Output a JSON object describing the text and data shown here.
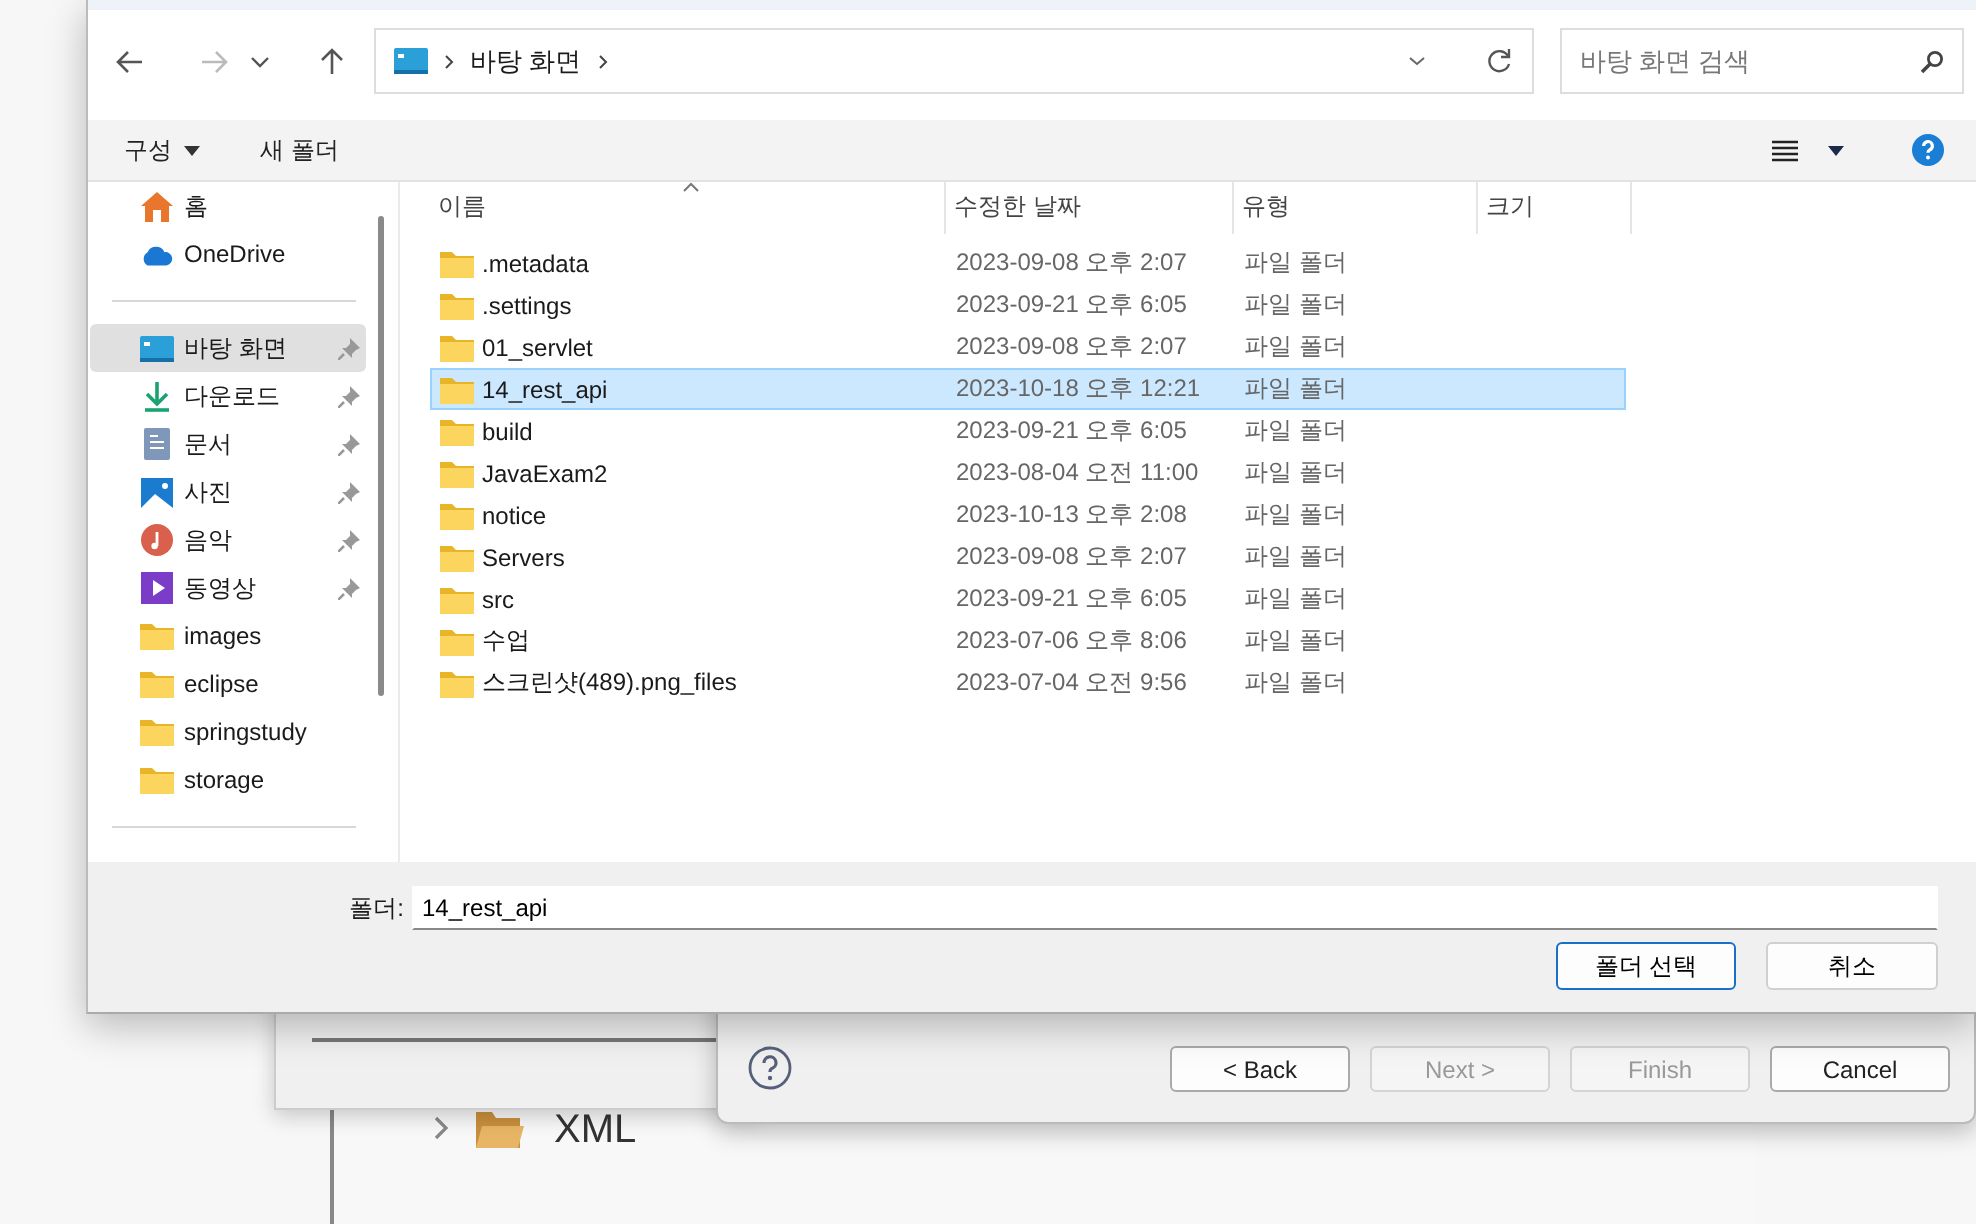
{
  "dialog": {
    "nav": {
      "breadcrumb": [
        "바탕 화면"
      ],
      "search": {
        "placeholder": "바탕 화면 검색"
      }
    },
    "toolbar": {
      "organize": "구성",
      "new_folder": "새 폴더"
    },
    "sidebar": {
      "groups": [
        {
          "items": [
            {
              "label": "홈",
              "kind": "home",
              "pinned": false,
              "selected": false
            },
            {
              "label": "OneDrive",
              "kind": "cloud",
              "pinned": false,
              "selected": false
            }
          ]
        },
        {
          "items": [
            {
              "label": "바탕 화면",
              "kind": "desktop",
              "pinned": true,
              "selected": true
            },
            {
              "label": "다운로드",
              "kind": "download",
              "pinned": true,
              "selected": false
            },
            {
              "label": "문서",
              "kind": "document",
              "pinned": true,
              "selected": false
            },
            {
              "label": "사진",
              "kind": "photo",
              "pinned": true,
              "selected": false
            },
            {
              "label": "음악",
              "kind": "music",
              "pinned": true,
              "selected": false
            },
            {
              "label": "동영상",
              "kind": "video",
              "pinned": true,
              "selected": false
            },
            {
              "label": "images",
              "kind": "folder",
              "pinned": false,
              "selected": false
            },
            {
              "label": "eclipse",
              "kind": "folder",
              "pinned": false,
              "selected": false
            },
            {
              "label": "springstudy",
              "kind": "folder",
              "pinned": false,
              "selected": false
            },
            {
              "label": "storage",
              "kind": "folder",
              "pinned": false,
              "selected": false
            }
          ]
        }
      ]
    },
    "file_list": {
      "columns": [
        "이름",
        "수정한 날짜",
        "유형",
        "크기"
      ],
      "rows": [
        {
          "name": ".metadata",
          "date": "2023-09-08 오후 2:07",
          "type": "파일 폴더",
          "selected": false
        },
        {
          "name": ".settings",
          "date": "2023-09-21 오후 6:05",
          "type": "파일 폴더",
          "selected": false
        },
        {
          "name": "01_servlet",
          "date": "2023-09-08 오후 2:07",
          "type": "파일 폴더",
          "selected": false
        },
        {
          "name": "14_rest_api",
          "date": "2023-10-18 오후 12:21",
          "type": "파일 폴더",
          "selected": true
        },
        {
          "name": "build",
          "date": "2023-09-21 오후 6:05",
          "type": "파일 폴더",
          "selected": false
        },
        {
          "name": "JavaExam2",
          "date": "2023-08-04 오전 11:00",
          "type": "파일 폴더",
          "selected": false
        },
        {
          "name": "notice",
          "date": "2023-10-13 오후 2:08",
          "type": "파일 폴더",
          "selected": false
        },
        {
          "name": "Servers",
          "date": "2023-09-08 오후 2:07",
          "type": "파일 폴더",
          "selected": false
        },
        {
          "name": "src",
          "date": "2023-09-21 오후 6:05",
          "type": "파일 폴더",
          "selected": false
        },
        {
          "name": "수업",
          "date": "2023-07-06 오후 8:06",
          "type": "파일 폴더",
          "selected": false
        },
        {
          "name": "스크린샷(489).png_files",
          "date": "2023-07-04 오전 9:56",
          "type": "파일 폴더",
          "selected": false
        }
      ]
    },
    "folder_field": {
      "label": "폴더:",
      "value": "14_rest_api"
    },
    "buttons": [
      {
        "label": "폴더 선택",
        "default": true
      },
      {
        "label": "취소",
        "default": false
      }
    ]
  },
  "background": {
    "wizard_buttons": [
      {
        "label": "< Back",
        "disabled": false
      },
      {
        "label": "Next >",
        "disabled": true
      },
      {
        "label": "Finish",
        "disabled": true
      },
      {
        "label": "Cancel",
        "disabled": false
      }
    ],
    "tree_item": "XML"
  }
}
